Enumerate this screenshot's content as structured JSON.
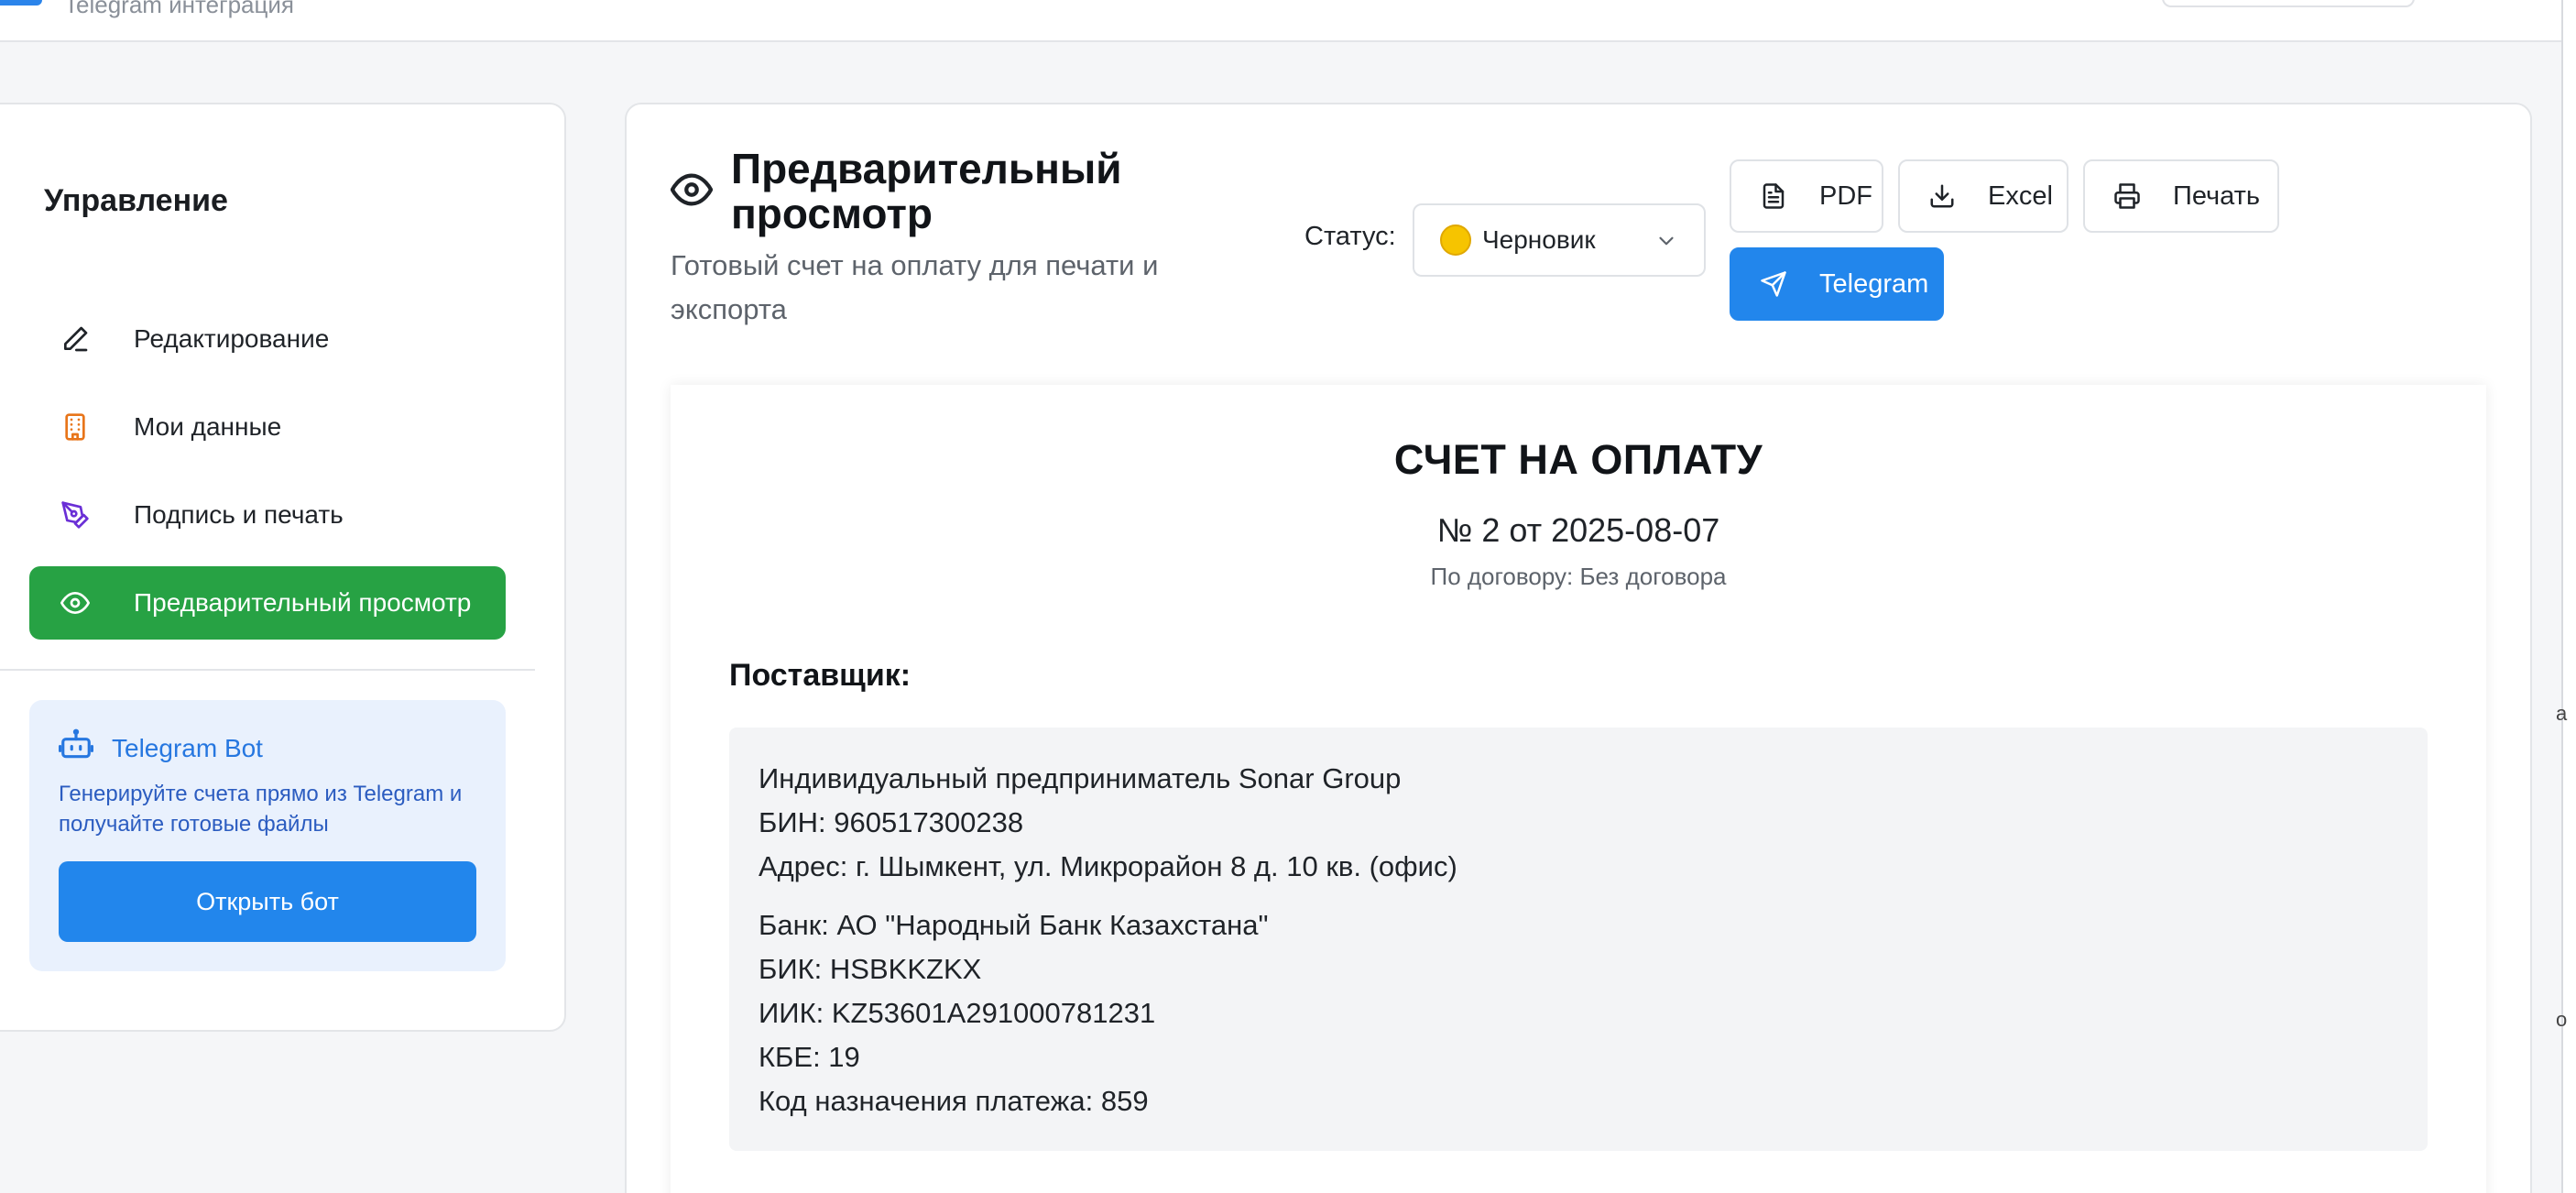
{
  "header": {
    "subtitle": "Telegram интеграция"
  },
  "sidebar": {
    "title": "Управление",
    "items": [
      {
        "label": "Редактирование",
        "icon": "pencil-icon"
      },
      {
        "label": "Мои данные",
        "icon": "building-icon"
      },
      {
        "label": "Подпись и печать",
        "icon": "pen-tool-icon"
      },
      {
        "label": "Предварительный просмотр",
        "icon": "eye-icon",
        "active": true
      }
    ],
    "telegram_card": {
      "title": "Telegram Bot",
      "description": "Генерируйте счета прямо из Telegram и получайте готовые файлы",
      "button": "Открыть бот"
    }
  },
  "main": {
    "title": "Предварительный просмотр",
    "subtitle": "Готовый счет на оплату для печати и экспорта",
    "status": {
      "label": "Статус:",
      "value": "Черновик"
    },
    "actions": {
      "pdf": "PDF",
      "excel": "Excel",
      "print": "Печать",
      "telegram": "Telegram"
    }
  },
  "invoice": {
    "title": "СЧЕТ НА ОПЛАТУ",
    "number_line": "№ 2 от 2025-08-07",
    "contract_line": "По договору: Без договора",
    "supplier_label": "Поставщик:",
    "supplier": {
      "name": "Индивидуальный предприниматель Sonar Group",
      "bin": "БИН: 960517300238",
      "address": "Адрес: г. Шымкент, ул. Микрорайон 8 д. 10 кв. (офис)",
      "bank": "Банк: АО \"Народный Банк Казахстана\"",
      "bik": "БИК: HSBKKZKX",
      "iik": "ИИК: KZ53601A291000781231",
      "kbe": "КБЕ: 19",
      "payment_code": "Код назначения платежа: 859"
    }
  },
  "edge": {
    "char1": "a",
    "char2": "o"
  },
  "colors": {
    "accent_green": "#27a244",
    "accent_blue": "#2286ec",
    "status_dot": "#f6c400"
  }
}
